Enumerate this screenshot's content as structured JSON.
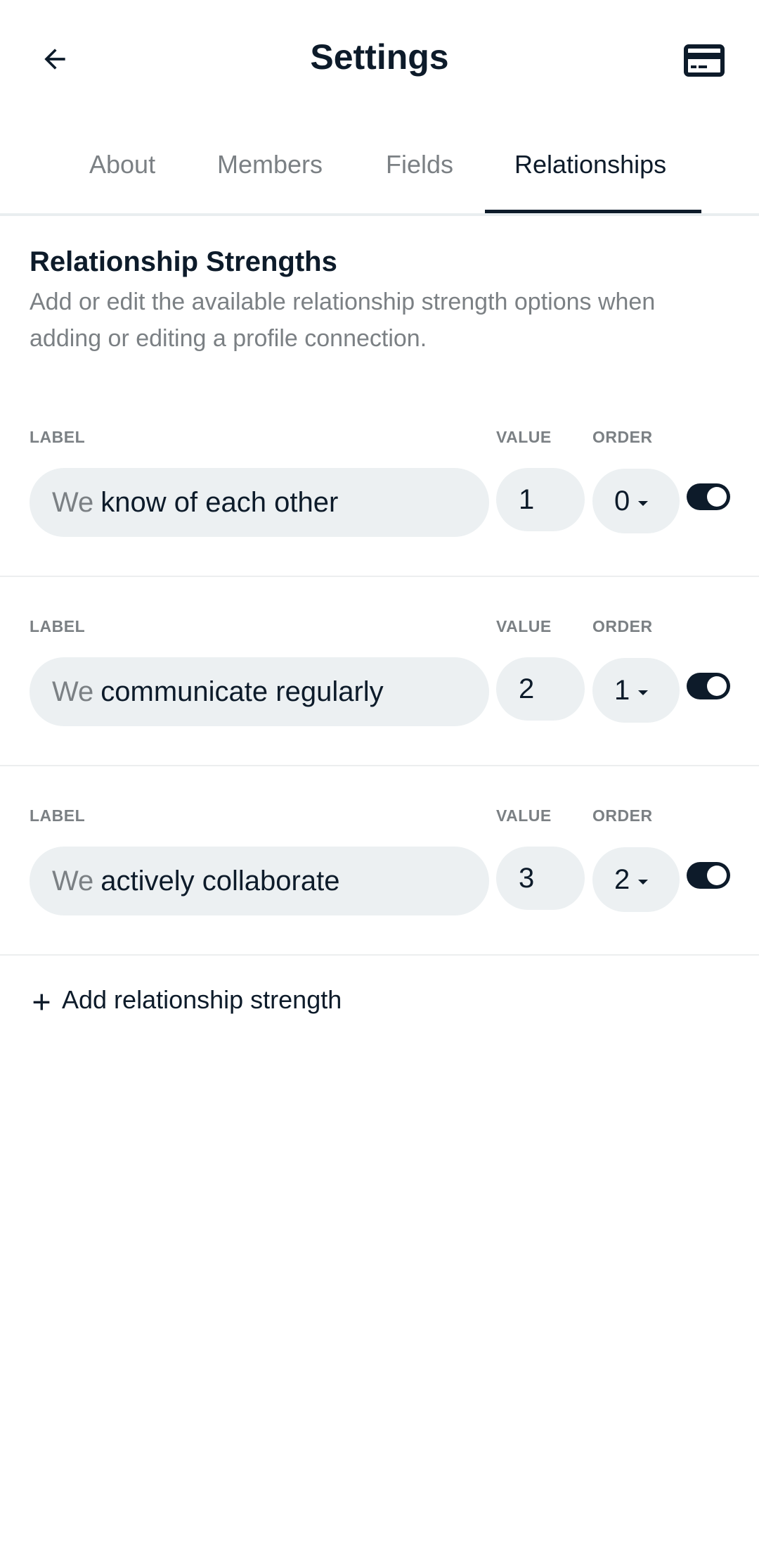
{
  "header": {
    "title": "Settings",
    "back_icon": "arrow-left-icon",
    "action_icon": "credit-card-icon"
  },
  "tabs": [
    {
      "label": "About"
    },
    {
      "label": "Members"
    },
    {
      "label": "Fields"
    },
    {
      "label": "Relationships",
      "active": true
    }
  ],
  "section": {
    "title": "Relationship Strengths",
    "description": "Add or edit the available relationship strength options when adding or editing a profile connection."
  },
  "columns": {
    "label": "LABEL",
    "value": "VALUE",
    "order": "ORDER"
  },
  "strengths": [
    {
      "prefix": "We",
      "label": "know of each other",
      "value": "1",
      "order": "0",
      "enabled": true
    },
    {
      "prefix": "We",
      "label": "communicate regularly",
      "value": "2",
      "order": "1",
      "enabled": true
    },
    {
      "prefix": "We",
      "label": "actively collaborate",
      "value": "3",
      "order": "2",
      "enabled": true
    }
  ],
  "add_button": {
    "label": "Add relationship strength",
    "icon": "plus-icon"
  },
  "colors": {
    "text": "#0d1b2a",
    "muted": "#7b8084",
    "pill": "#ecf0f2",
    "accent": "#0d1b2a"
  }
}
